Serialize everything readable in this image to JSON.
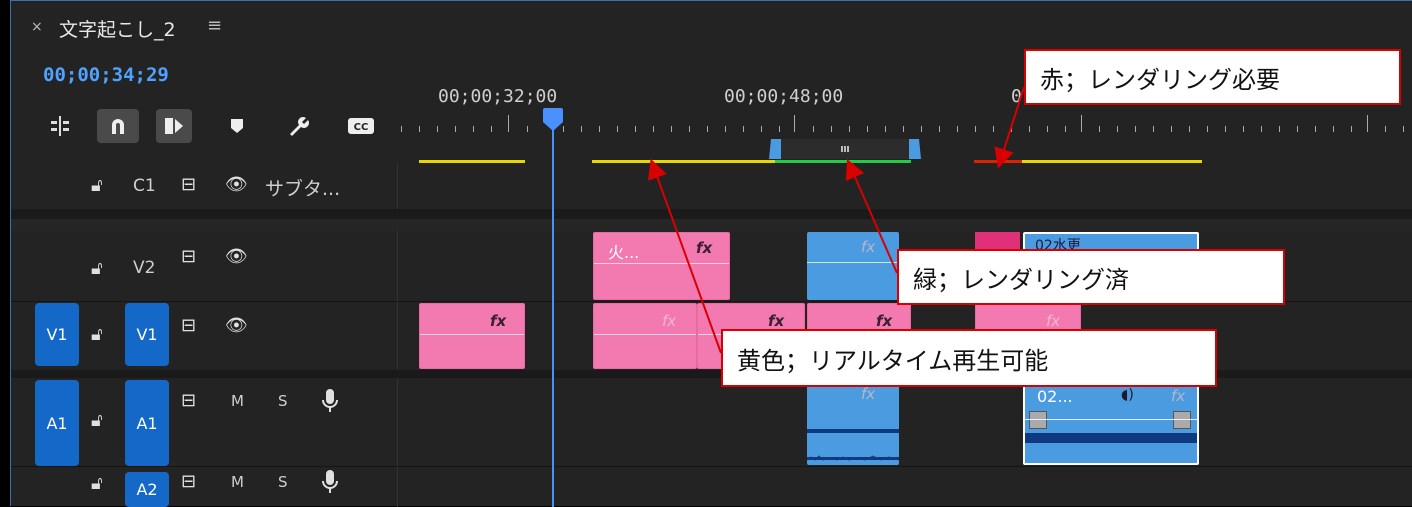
{
  "panel": {
    "close_icon": "×",
    "title": "文字起こし_2",
    "menu_icon": "≡",
    "timecode": "00;00;34;29"
  },
  "ruler": {
    "labels": [
      "00;00;32;00",
      "00;00;48;00",
      "0"
    ]
  },
  "tracks": {
    "c1": {
      "label": "C1",
      "name": "サブタ..."
    },
    "v2": {
      "label": "V2"
    },
    "v1": {
      "label": "V1",
      "source": "V1"
    },
    "a1": {
      "label": "A1",
      "source": "A1",
      "m": "M",
      "s": "S"
    },
    "a2": {
      "label": "A2",
      "m": "M",
      "s": "S"
    }
  },
  "clips": {
    "v2_pink_title": "火...",
    "v2_right_title": "02水更",
    "a1_clip_title": "02...",
    "fx": "fx"
  },
  "callouts": {
    "red": "赤；レンダリング必要",
    "green": "緑；レンダリング済",
    "yellow": "黄色；リアルタイム再生可能"
  },
  "colors": {
    "accent": "#4fa3ff",
    "track_button": "#1468c8",
    "clip_pink": "#f37ab0",
    "clip_blue": "#4a9be0",
    "render_yellow": "#e8d800",
    "render_green": "#22cc44",
    "render_red": "#dd2200",
    "callout_border": "#d90000"
  }
}
